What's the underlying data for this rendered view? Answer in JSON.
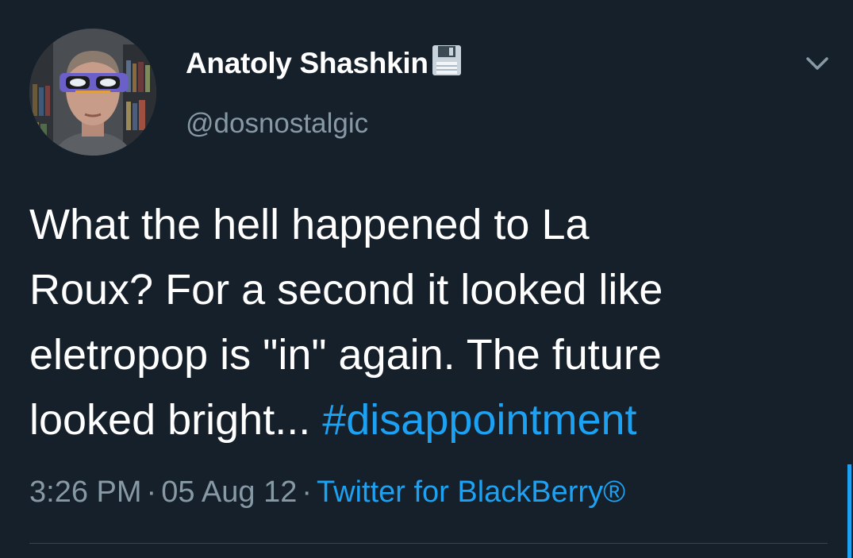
{
  "tweet": {
    "author": {
      "display_name": "Anatoly Shashkin",
      "handle": "@dosnostalgic",
      "name_emoji": "floppy-disk-icon"
    },
    "text": {
      "lines": [
        "What the hell happened to La",
        "Roux? For a second it looked like",
        "eletropop is \"in\" again. The future",
        "looked bright... "
      ],
      "hashtag": "#disappointment"
    },
    "meta": {
      "time": "3:26 PM",
      "separator": "·",
      "date": "05 Aug 12",
      "source": "Twitter for BlackBerry®"
    },
    "menu_icon": "chevron-down-icon"
  },
  "colors": {
    "background": "#15202b",
    "text": "#ffffff",
    "secondary": "#8899a6",
    "accent": "#1da1f2",
    "divider": "#38444d"
  }
}
